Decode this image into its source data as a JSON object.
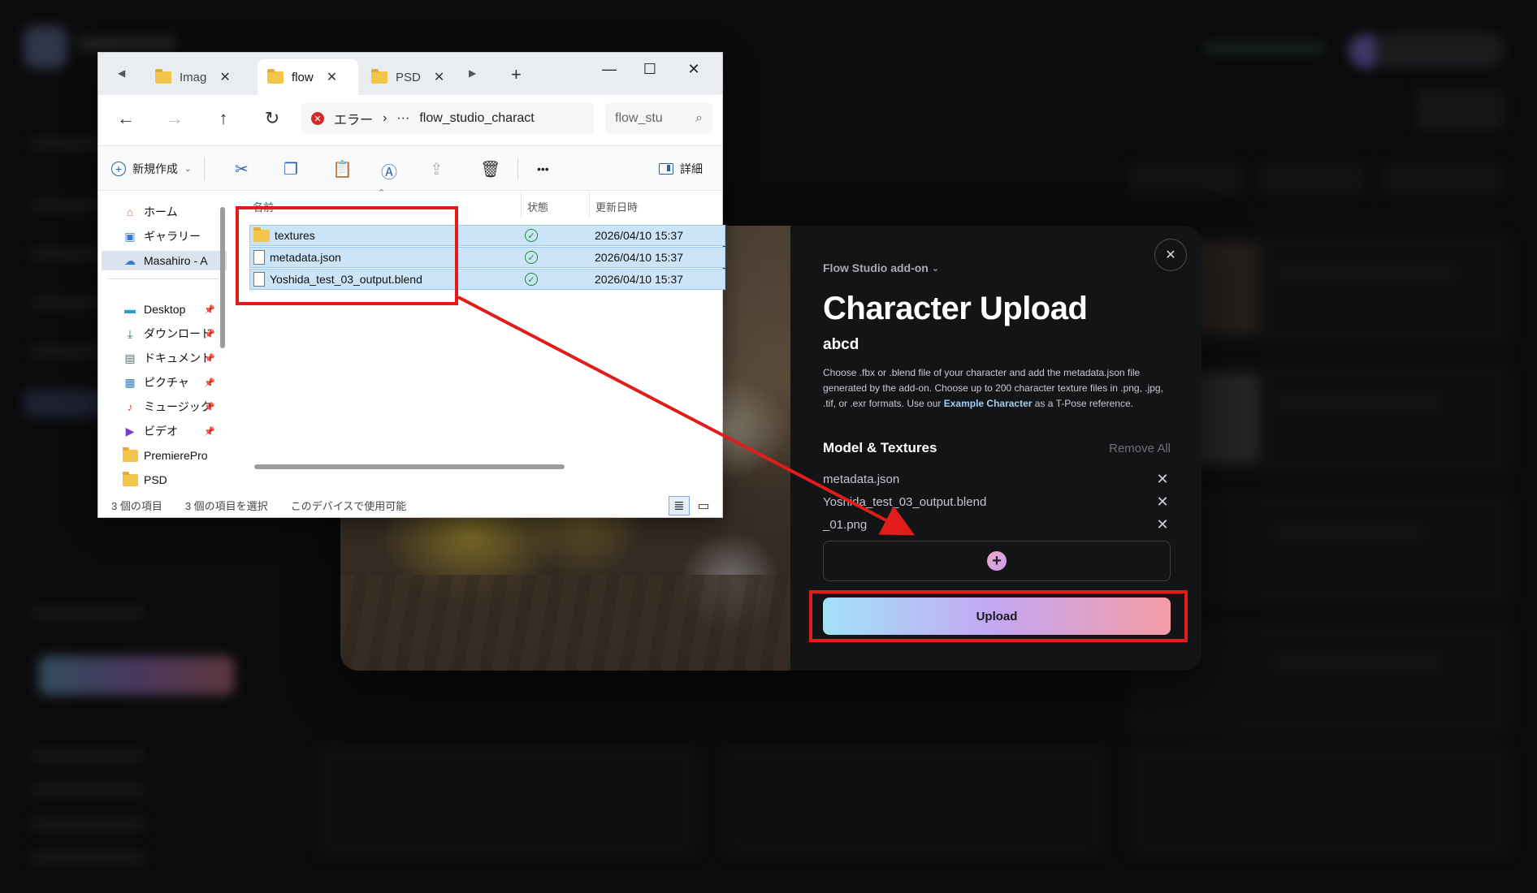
{
  "explorer": {
    "tabs": [
      {
        "label": "Imag",
        "active": false
      },
      {
        "label": "flow",
        "active": true
      },
      {
        "label": "PSD",
        "active": false
      }
    ],
    "address": {
      "error_label": "エラー",
      "ellipsis": "···",
      "path": "flow_studio_charact",
      "chevron": "›"
    },
    "search_placeholder": "flow_stu",
    "toolbar": {
      "new_label": "新規作成",
      "more_label": "•••",
      "details_label": "詳細"
    },
    "sidebar": {
      "items": [
        {
          "label": "ホーム",
          "icon": "home-icon"
        },
        {
          "label": "ギャラリー",
          "icon": "gallery-icon"
        },
        {
          "label": "Masahiro - A",
          "icon": "onedrive-icon"
        },
        {
          "label": "Desktop",
          "icon": "desktop-icon"
        },
        {
          "label": "ダウンロード",
          "icon": "download-icon"
        },
        {
          "label": "ドキュメント",
          "icon": "documents-icon"
        },
        {
          "label": "ピクチャ",
          "icon": "pictures-icon"
        },
        {
          "label": "ミュージック",
          "icon": "music-icon"
        },
        {
          "label": "ビデオ",
          "icon": "video-icon"
        },
        {
          "label": "PremierePro",
          "icon": "folder-icon"
        },
        {
          "label": "PSD",
          "icon": "folder-icon"
        }
      ]
    },
    "columns": {
      "name": "名前",
      "status": "状態",
      "modified": "更新日時"
    },
    "files": [
      {
        "name": "textures",
        "type": "folder",
        "modified": "2026/04/10 15:37"
      },
      {
        "name": "metadata.json",
        "type": "file",
        "modified": "2026/04/10 15:37"
      },
      {
        "name": "Yoshida_test_03_output.blend",
        "type": "file",
        "modified": "2026/04/10 15:37"
      }
    ],
    "status": {
      "count": "3 個の項目",
      "selected": "3 個の項目を選択",
      "availability": "このデバイスで使用可能"
    }
  },
  "modal": {
    "addon_label": "Flow Studio add-on",
    "title": "Character Upload",
    "subtitle": "abcd",
    "description_before": "Choose .fbx or .blend file of your character and add the metadata.json file generated by the add-on. Choose up to 200 character texture files in .png, .jpg, .tif, or .exr formats. Use our ",
    "description_link": "Example Character",
    "description_after": " as a T-Pose reference.",
    "section_title": "Model & Textures",
    "remove_all_label": "Remove All",
    "files": [
      "metadata.json",
      "Yoshida_test_03_output.blend",
      "_01.png"
    ],
    "upload_label": "Upload",
    "colors": {
      "panel": "#131416",
      "upload_gradient": [
        "#a2e2f8",
        "#c5a6f2",
        "#f49ca4"
      ],
      "annotation": "#e21b1b"
    }
  }
}
